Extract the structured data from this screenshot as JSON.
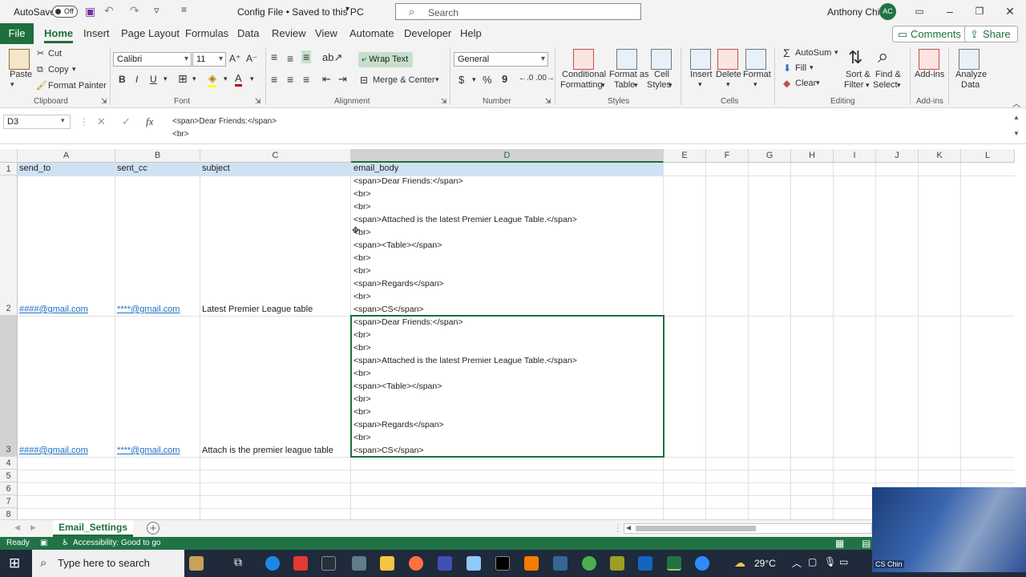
{
  "titlebar": {
    "autosave_label": "AutoSave",
    "autosave_state": "Off",
    "file_title": "Config File • Saved to this PC",
    "search_placeholder": "Search",
    "user_name": "Anthony Chin",
    "user_initials": "AC"
  },
  "ribbon_tabs": [
    "File",
    "Home",
    "Insert",
    "Page Layout",
    "Formulas",
    "Data",
    "Review",
    "View",
    "Automate",
    "Developer",
    "Help"
  ],
  "ribbon_actions": {
    "comments": "Comments",
    "share": "Share"
  },
  "ribbon": {
    "clipboard": {
      "paste": "Paste",
      "cut": "Cut",
      "copy": "Copy",
      "format_painter": "Format Painter",
      "group": "Clipboard"
    },
    "font": {
      "name": "Calibri",
      "size": "11",
      "bold": "B",
      "italic": "I",
      "underline": "U",
      "group": "Font"
    },
    "alignment": {
      "wrap_text": "Wrap Text",
      "merge_center": "Merge & Center",
      "group": "Alignment"
    },
    "number": {
      "format": "General",
      "currency": "$",
      "percent": "%",
      "comma": "9",
      "group": "Number"
    },
    "styles": {
      "conditional": "Conditional",
      "formatting": "Formatting",
      "format_as": "Format as",
      "table": "Table",
      "cell": "Cell",
      "cell_styles": "Styles",
      "group": "Styles"
    },
    "cells": {
      "insert": "Insert",
      "delete": "Delete",
      "format": "Format",
      "group": "Cells"
    },
    "editing": {
      "autosum": "AutoSum",
      "fill": "Fill",
      "clear": "Clear",
      "sort": "Sort &",
      "filter": "Filter",
      "find": "Find &",
      "select": "Select",
      "group": "Editing"
    },
    "addins": {
      "addins": "Add-ins",
      "group": "Add-ins"
    },
    "analyze": {
      "line1": "Analyze",
      "line2": "Data"
    }
  },
  "formula_bar": {
    "name_box": "D3",
    "fx": "fx",
    "line1": "<span>Dear Friends:</span>",
    "line2": "<br>"
  },
  "columns": [
    "A",
    "B",
    "C",
    "D",
    "E",
    "F",
    "G",
    "H",
    "I",
    "J",
    "K",
    "L"
  ],
  "rows": [
    "1",
    "2",
    "3",
    "4",
    "5",
    "6",
    "7",
    "8"
  ],
  "header_row": {
    "a": "send_to",
    "b": "sent_cc",
    "c": "subject",
    "d": "email_body"
  },
  "row2": {
    "a": "####@gmail.com",
    "b": "****@gmail.com",
    "c": "Latest Premier League table"
  },
  "row3": {
    "a": "####@gmail.com",
    "b": "****@gmail.com",
    "c": "Attach is the premier league table"
  },
  "email_body_lines": [
    "<span>Dear Friends:</span>",
    "<br>",
    "<br>",
    "<span>Attached is the latest Premier League Table.</span>",
    "<br>",
    "<span><Table></span>",
    "<br>",
    "<br>",
    "<span>Regards</span>",
    "<br>",
    "<span>CS</span>"
  ],
  "sheet": {
    "name": "Email_Settings",
    "add": "+"
  },
  "status": {
    "ready": "Ready",
    "accessibility": "Accessibility: Good to go"
  },
  "taskbar": {
    "search_placeholder": "Type here to search",
    "weather": "29°C",
    "webcam_name": "CS Chin"
  },
  "colors": {
    "excel_green": "#217346",
    "header_blue": "#cfe2f3",
    "link_blue": "#1f6fc5"
  }
}
